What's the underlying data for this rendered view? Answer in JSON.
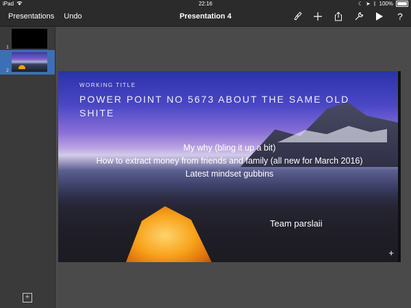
{
  "status_bar": {
    "device": "iPad",
    "time": "22:16",
    "battery_text": "100%"
  },
  "toolbar": {
    "presentations_label": "Presentations",
    "undo_label": "Undo",
    "title": "Presentation 4",
    "icons": [
      "brush-icon",
      "plus-icon",
      "share-icon",
      "wrench-icon",
      "play-icon",
      "help-icon"
    ],
    "help_glyph": "?"
  },
  "sidebar": {
    "slides": [
      {
        "number": "1"
      },
      {
        "number": "2"
      }
    ],
    "add_glyph": "+"
  },
  "slide": {
    "subtitle": "WORKING TITLE",
    "title": "POWER POINT NO 5673 ABOUT THE SAME OLD SHITE",
    "bullets": [
      "My why (bling it up a bit)",
      "How to extract money from friends and family (all new for March 2016)",
      "Latest mindset gubbins"
    ],
    "team": "Team parslaii",
    "add_glyph": "+"
  }
}
